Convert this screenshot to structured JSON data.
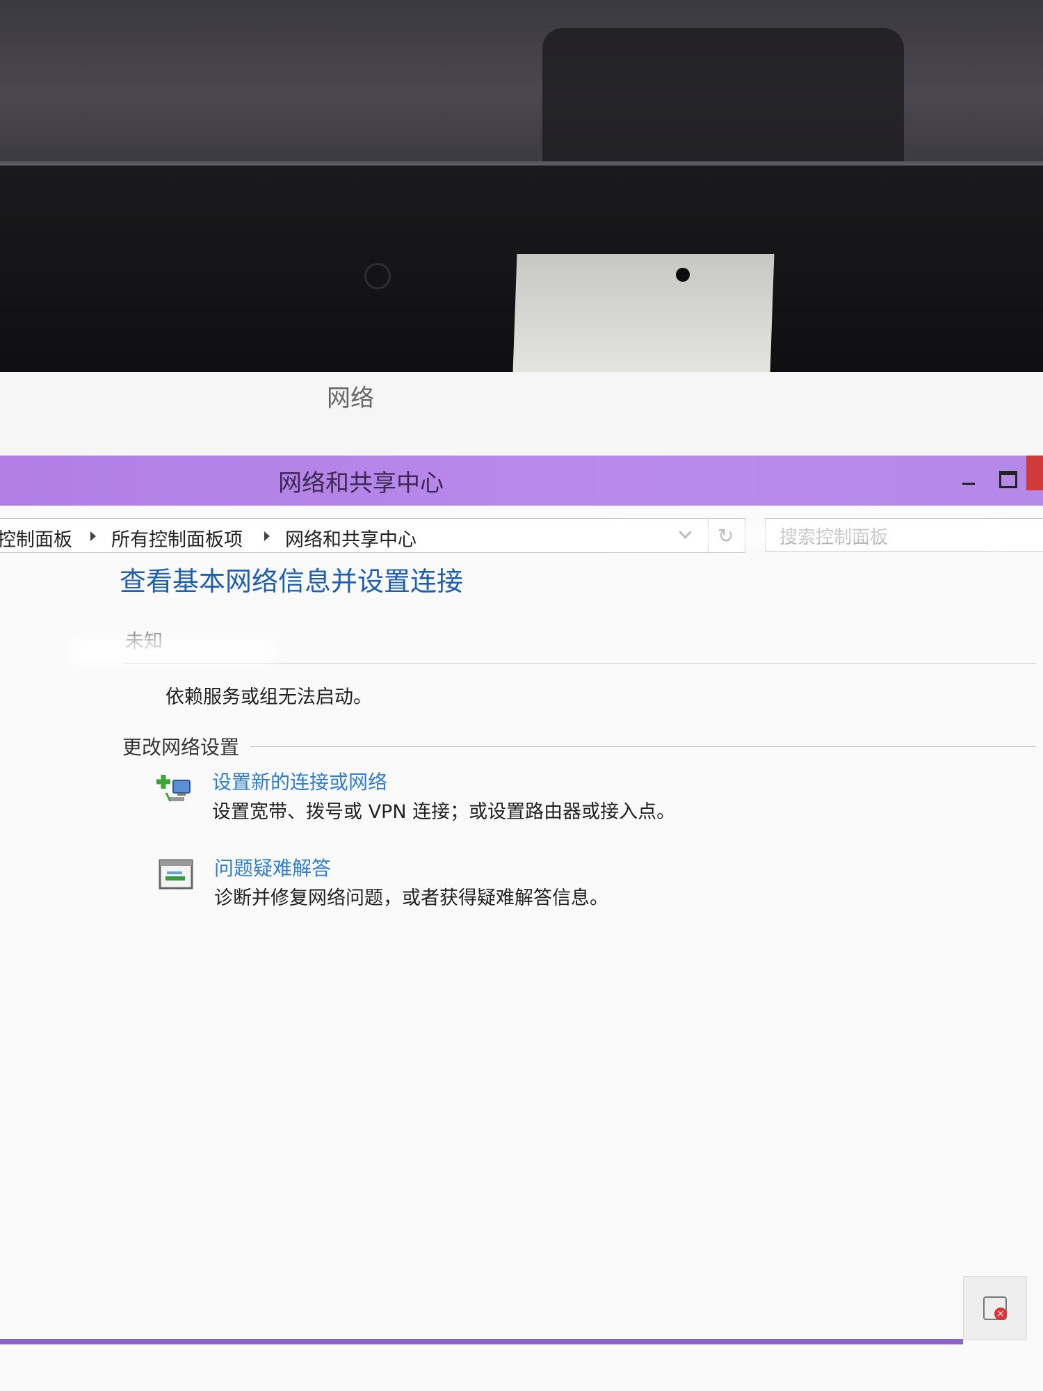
{
  "parent_window": {
    "title": "网络"
  },
  "window": {
    "title": "网络和共享中心"
  },
  "address_bar": {
    "crumbs": [
      "控制面板",
      "所有控制面板项",
      "网络和共享中心"
    ]
  },
  "search": {
    "placeholder": "搜索控制面板"
  },
  "content": {
    "title": "查看基本网络信息并设置连接",
    "network_label": "未知",
    "error_message": "依赖服务或组无法启动。",
    "change_settings_heading": "更改网络设置",
    "tasks": [
      {
        "icon": "network-setup-icon",
        "link": "设置新的连接或网络",
        "description": "设置宽带、拨号或 VPN 连接；或设置路由器或接入点。"
      },
      {
        "icon": "troubleshoot-icon",
        "link": "问题疑难解答",
        "description": "诊断并修复网络问题，或者获得疑难解答信息。"
      }
    ]
  },
  "tray": {
    "icon": "network-error-icon"
  },
  "colors": {
    "titlebar": "#b27ee6",
    "heading_blue": "#1f5fb0",
    "link_blue": "#2f7fd0"
  }
}
